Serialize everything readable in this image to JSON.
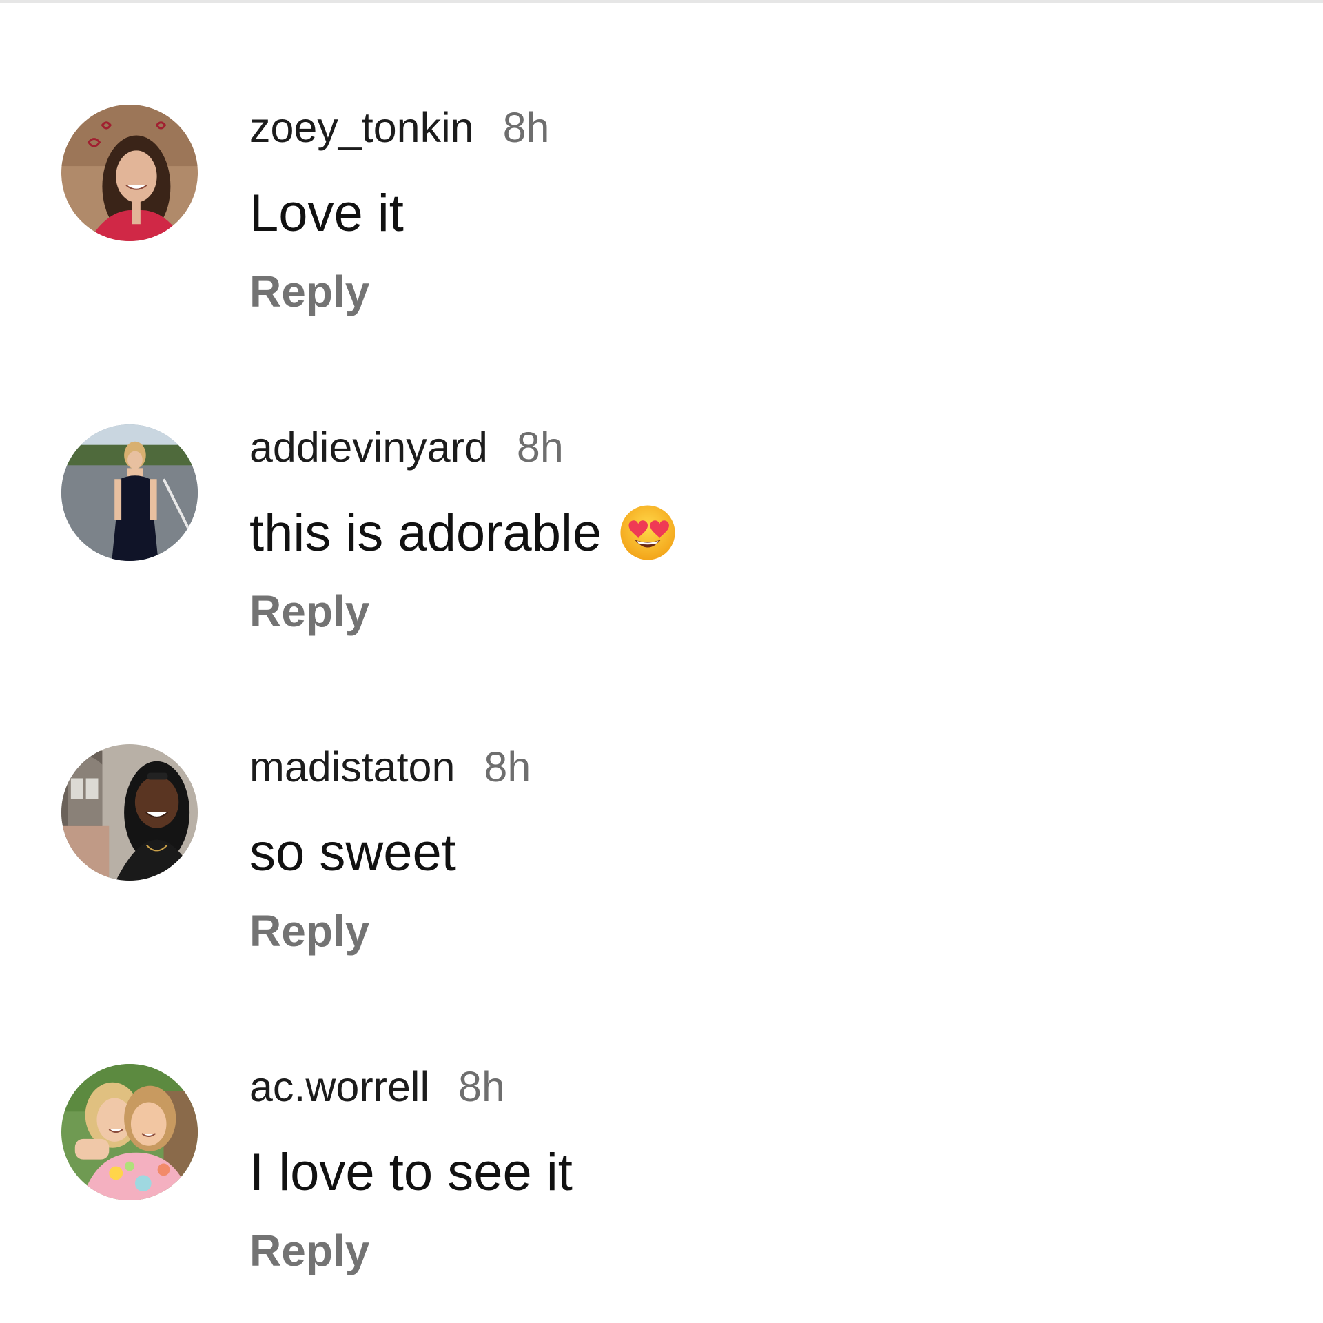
{
  "comments": [
    {
      "username": "zoey_tonkin",
      "time": "8h",
      "text": "Love it",
      "reply_label": "Reply",
      "avatar_icon": "profile-photo-avatar"
    },
    {
      "username": "addievinyard",
      "time": "8h",
      "text": "this is adorable",
      "emoji_icon": "heart-eyes-emoji-icon",
      "reply_label": "Reply",
      "avatar_icon": "profile-photo-avatar"
    },
    {
      "username": "madistaton",
      "time": "8h",
      "text": "so sweet",
      "reply_label": "Reply",
      "avatar_icon": "profile-photo-avatar"
    },
    {
      "username": "ac.worrell",
      "time": "8h",
      "text": "I love to see it",
      "reply_label": "Reply",
      "avatar_icon": "profile-photo-avatar"
    }
  ],
  "colors": {
    "username": "#1c1c1c",
    "timestamp": "#6e6e6e",
    "reply": "#737373",
    "background": "#ffffff"
  }
}
